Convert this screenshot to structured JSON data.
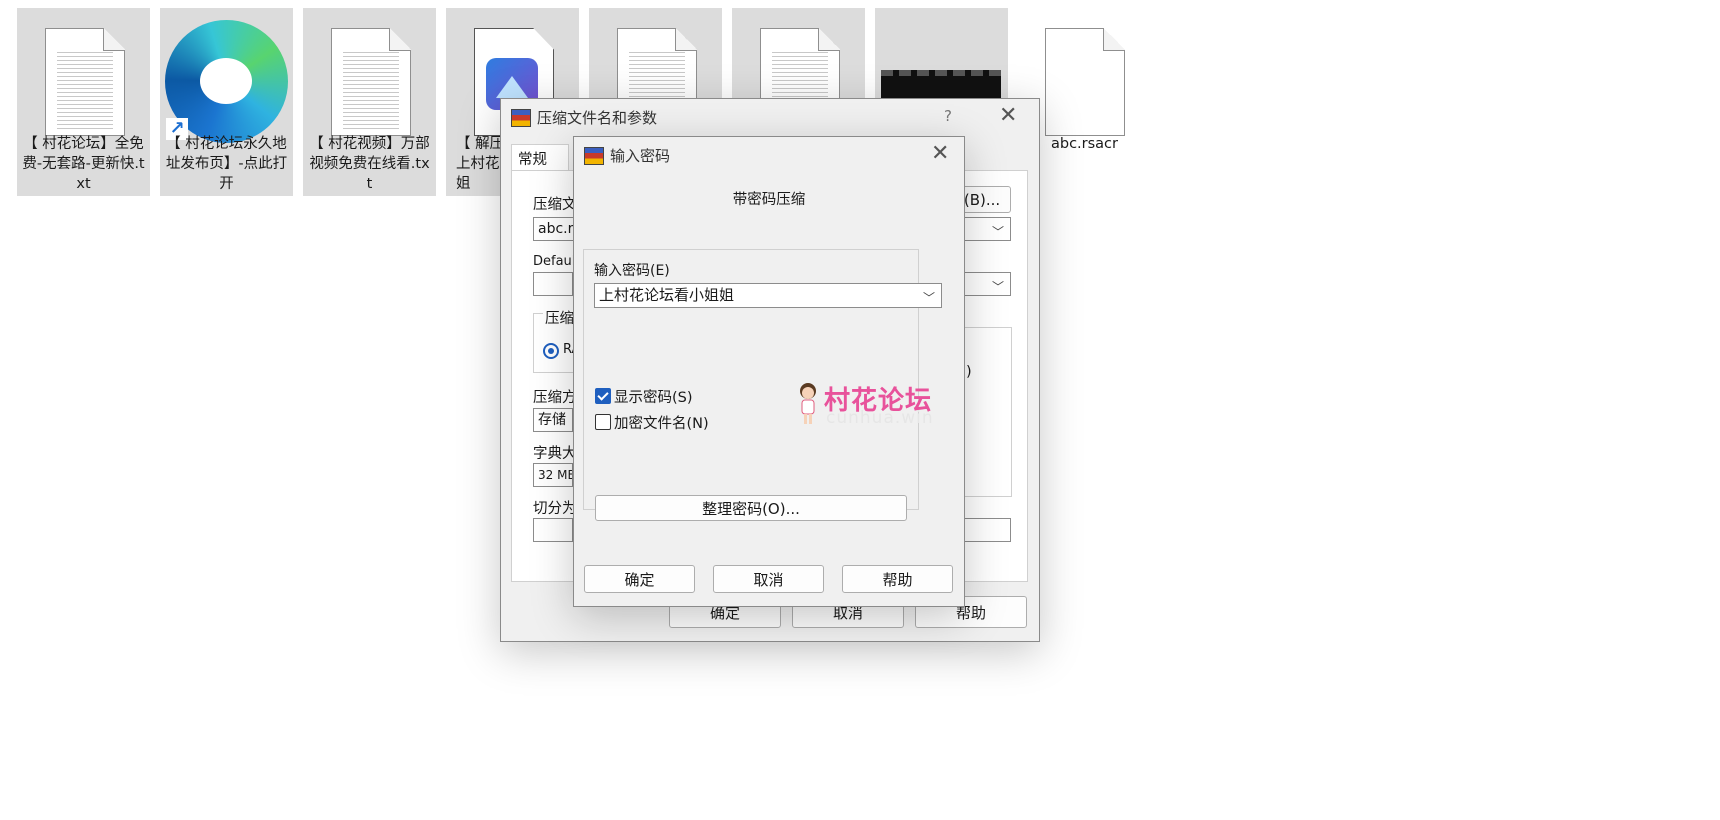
{
  "desktop": {
    "files": [
      {
        "name": "【 村花论坛】全免费-无套路-更新快.txt",
        "type": "text"
      },
      {
        "name": "【 村花论坛永久地址发布页】-点此打开",
        "type": "edge-shortcut"
      },
      {
        "name": "【 村花视频】万部视频免费在线看.txt",
        "type": "text"
      },
      {
        "name": "【 解压上村花姐",
        "type": "image"
      },
      {
        "name": "",
        "type": "text"
      },
      {
        "name": "",
        "type": "text"
      },
      {
        "name": "",
        "type": "video"
      },
      {
        "name": "abc.rsacr",
        "type": "blank"
      }
    ]
  },
  "archive_dialog": {
    "title": "压缩文件名和参数",
    "help_icon": "?",
    "close_icon": "close-icon",
    "tab_general": "常规",
    "archive_name_label": "压缩文",
    "archive_name_value": "abc.ra",
    "browse_button": "(B)...",
    "profile_label": "Default",
    "format_group_label": "压缩",
    "format_rar": "RA",
    "method_label": "压缩方",
    "method_value": "存储",
    "dict_label": "字典大",
    "dict_value": "32 MB",
    "split_label": "切分为",
    "right_fragment": ")",
    "ok": "确定",
    "cancel": "取消",
    "help": "帮助"
  },
  "password_dialog": {
    "title": "输入密码",
    "close_icon": "close-icon",
    "heading": "带密码压缩",
    "enter_label": "输入密码(E)",
    "password_value": "上村花论坛看小姐姐",
    "show_password": {
      "label": "显示密码(S)",
      "checked": true
    },
    "encrypt_names": {
      "label": "加密文件名(N)",
      "checked": false
    },
    "organize_button": "整理密码(O)...",
    "ok": "确定",
    "cancel": "取消",
    "help": "帮助",
    "watermark_text": "村花论坛",
    "watermark_sub": "cunhua.win"
  }
}
